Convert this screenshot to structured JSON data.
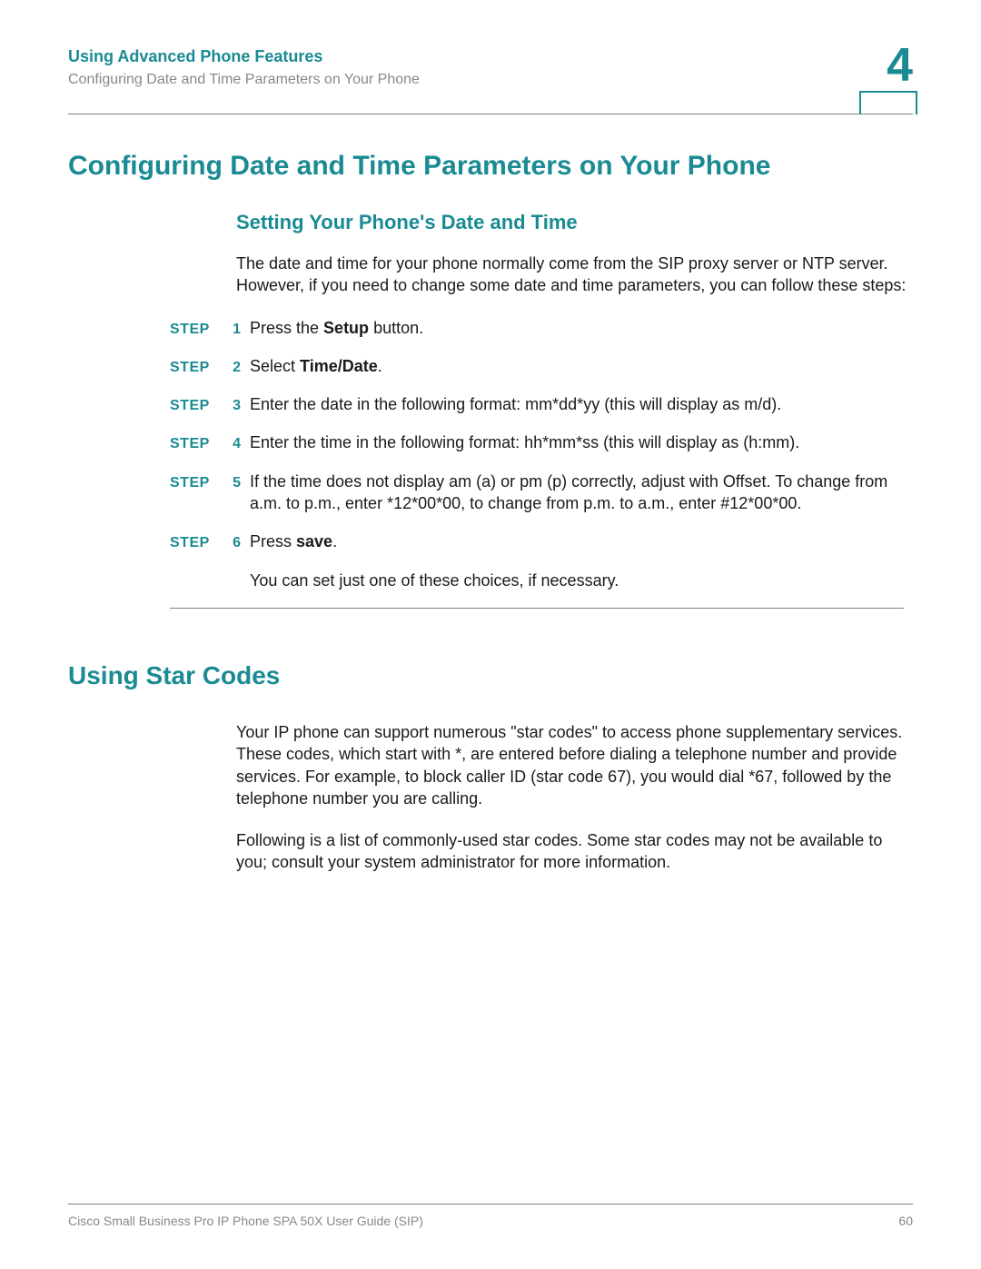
{
  "header": {
    "chapter_title": "Using Advanced Phone Features",
    "section_sub": "Configuring Date and Time Parameters on Your Phone",
    "chapter_number": "4"
  },
  "h1": "Configuring Date and Time Parameters on Your Phone",
  "section1": {
    "h2": "Setting Your Phone's Date and Time",
    "intro": "The date and time for your phone normally come from the SIP proxy server or NTP server. However, if you need to change some date and time parameters, you can follow these steps:"
  },
  "steps": {
    "label": "STEP",
    "items": [
      {
        "n": "1",
        "pre": "Press the ",
        "bold": "Setup",
        "post": " button."
      },
      {
        "n": "2",
        "pre": "Select ",
        "bold": "Time/Date",
        "post": "."
      },
      {
        "n": "3",
        "pre": "Enter the date in the following format: mm*dd*yy (this will display as m/d).",
        "bold": "",
        "post": ""
      },
      {
        "n": "4",
        "pre": "Enter the time in the following format: hh*mm*ss (this will display as (h:mm).",
        "bold": "",
        "post": ""
      },
      {
        "n": "5",
        "pre": "If the time does not display am (a) or pm (p) correctly, adjust with Offset. To change from a.m. to p.m., enter *12*00*00, to change from p.m. to a.m., enter #12*00*00.",
        "bold": "",
        "post": ""
      },
      {
        "n": "6",
        "pre": "Press ",
        "bold": "save",
        "post": "."
      }
    ],
    "tail": "You can set just one of these choices, if necessary."
  },
  "section2": {
    "h1": "Using Star Codes",
    "p1": "Your IP phone can support numerous \"star codes\" to access phone supplementary services. These codes, which start with *, are entered before dialing a telephone number and provide services. For example, to block caller ID (star code 67), you would dial *67, followed by the telephone number you are calling.",
    "p2": "Following is a list of commonly-used star codes. Some star codes may not be available to you; consult your system administrator for more information."
  },
  "footer": {
    "doc": "Cisco Small Business Pro IP Phone SPA 50X User Guide (SIP)",
    "page": "60"
  }
}
